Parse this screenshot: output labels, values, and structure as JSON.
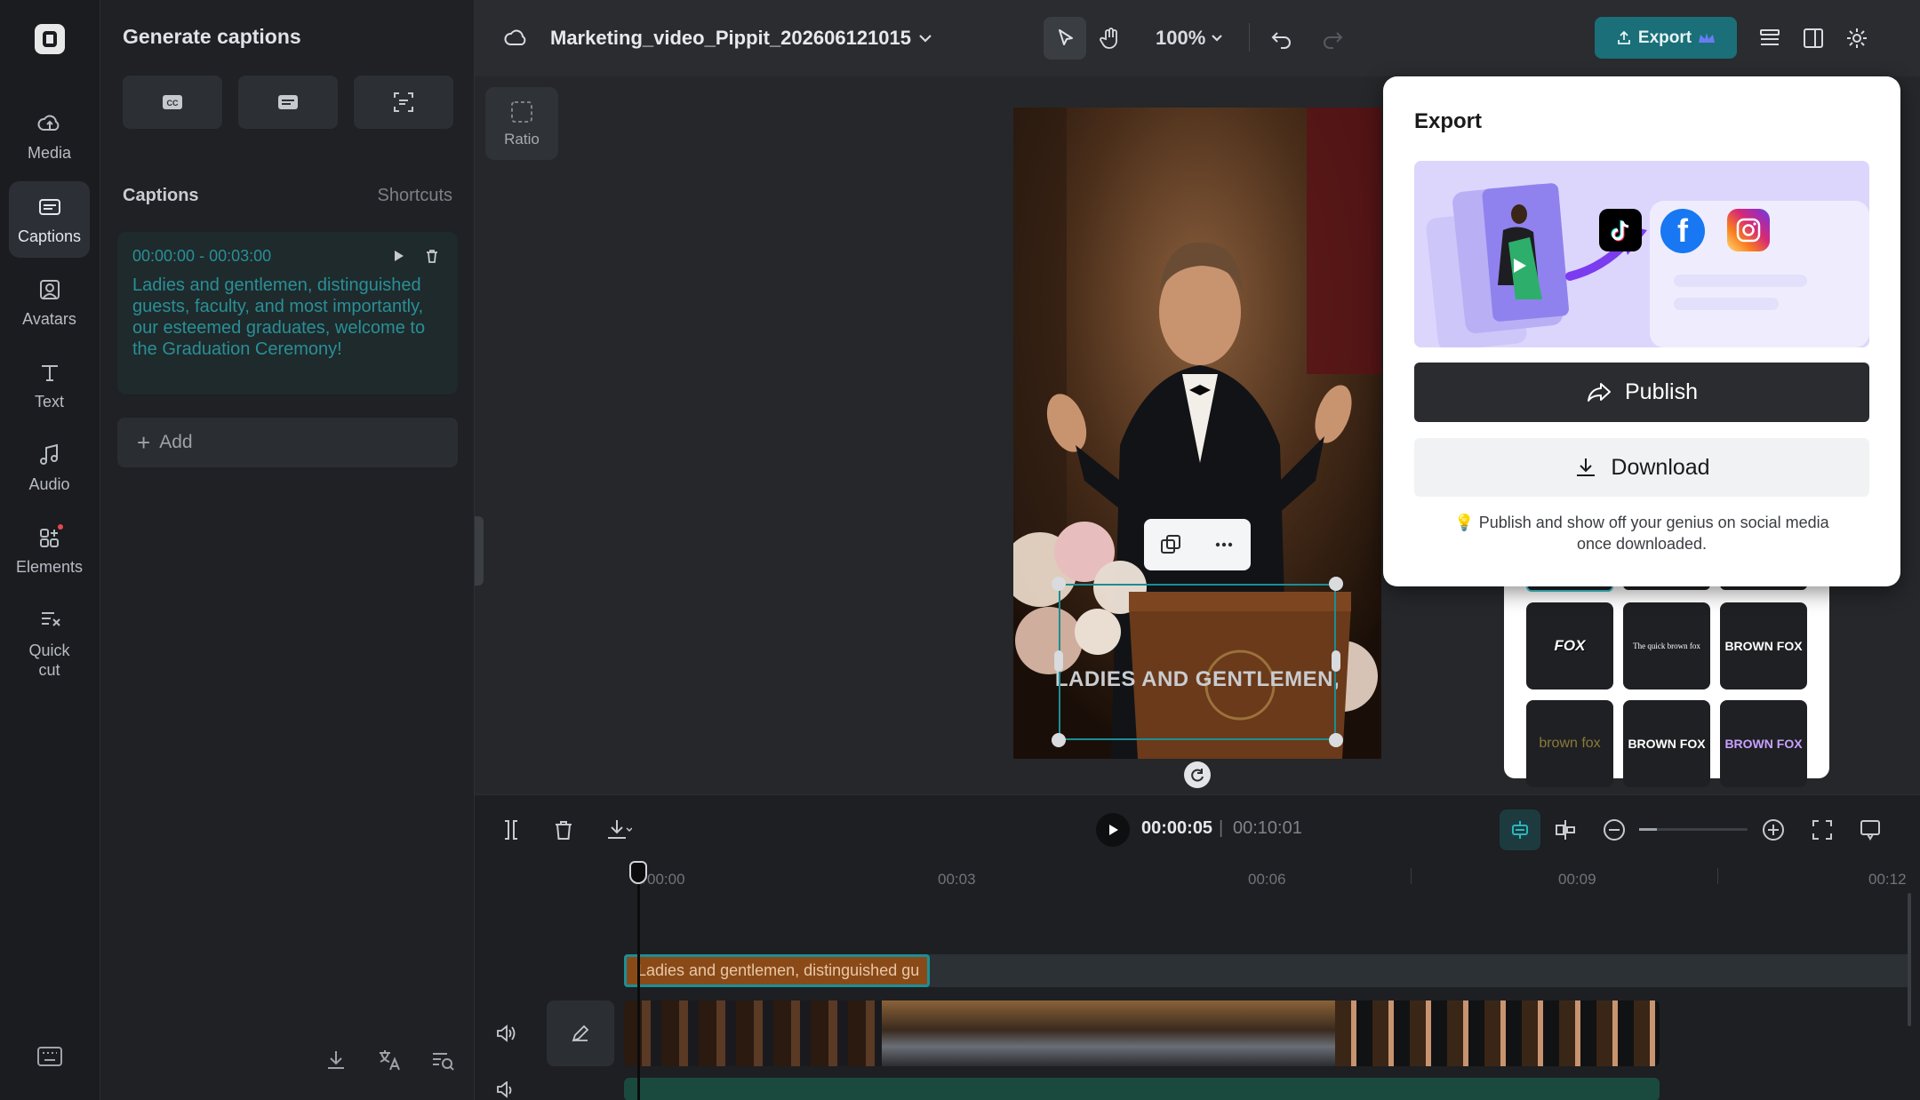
{
  "rail": {
    "items": [
      {
        "label": "Media",
        "icon": "cloud-icon"
      },
      {
        "label": "Captions",
        "icon": "captions-icon",
        "active": true
      },
      {
        "label": "Avatars",
        "icon": "avatar-icon"
      },
      {
        "label": "Text",
        "icon": "text-icon"
      },
      {
        "label": "Audio",
        "icon": "music-icon"
      },
      {
        "label": "Elements",
        "icon": "elements-icon"
      },
      {
        "label": "Quick\ncut",
        "icon": "quick-cut-icon"
      }
    ]
  },
  "panel": {
    "title": "Generate captions",
    "section_title": "Captions",
    "shortcuts": "Shortcuts",
    "caption": {
      "time": "00:00:00 - 00:03:00",
      "text": "Ladies and gentlemen, distinguished guests, faculty, and most importantly, our esteemed graduates, welcome to the Graduation  Ceremony!"
    },
    "add_label": "Add"
  },
  "topbar": {
    "project_title": "Marketing_video_Pippit_202606121015",
    "zoom": "100%",
    "export_label": "Export"
  },
  "canvas": {
    "ratio_label": "Ratio",
    "overlay_caption": "LADIES AND GENTLEMEN,"
  },
  "export_popup": {
    "title": "Export",
    "publish_label": "Publish",
    "download_label": "Download",
    "note": "Publish and show off your genius on social media once downloaded.",
    "platforms": [
      "tiktok-icon",
      "facebook-icon",
      "instagram-icon"
    ]
  },
  "caption_styles": {
    "tiles": [
      {
        "text": "FOX",
        "color": "#ffffff"
      },
      {
        "text": "The quick brown fox",
        "color": "#ffffff"
      },
      {
        "text": "BROWN FOX",
        "color": "#ffffff",
        "accent": "#20d0d8"
      },
      {
        "text": "brown fox",
        "color": "#8c7a3a"
      },
      {
        "text": "BROWN FOX",
        "color": "#ffffff",
        "accent": "#ff9a3c"
      },
      {
        "text": "BROWN FOX",
        "color": "#c9a0ff"
      }
    ]
  },
  "timeline": {
    "current_time": "00:00:05",
    "separator": "|",
    "total_time": "00:10:01",
    "ruler": [
      "00:00",
      "00:03",
      "00:06",
      "00:09",
      "00:12"
    ],
    "caption_clip_text": "Ladies and gentlemen, distinguished gu"
  },
  "colors": {
    "accent": "#1a6f78",
    "caption_text": "#2a8f96"
  }
}
